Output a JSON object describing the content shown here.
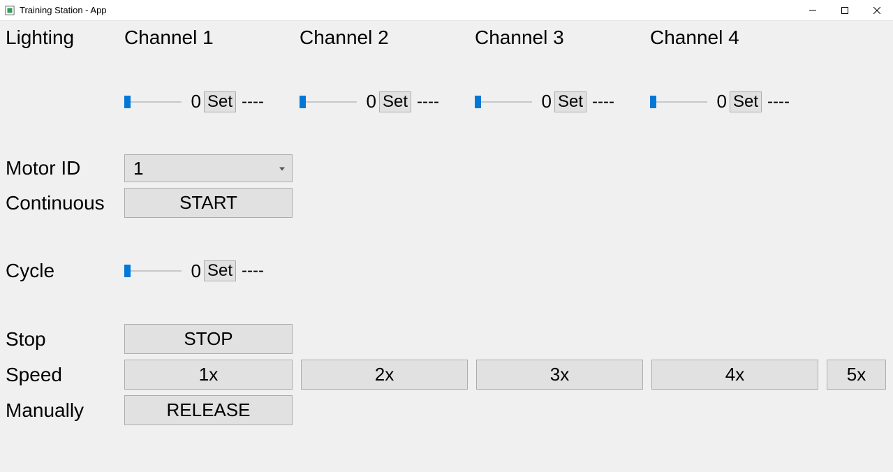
{
  "window": {
    "title": "Training Station - App"
  },
  "labels": {
    "lighting": "Lighting",
    "motor_id": "Motor ID",
    "continuous": "Continuous",
    "cycle": "Cycle",
    "stop": "Stop",
    "speed": "Speed",
    "manually": "Manually"
  },
  "channels": [
    {
      "label": "Channel 1",
      "value": "0",
      "set": "Set",
      "status": "----"
    },
    {
      "label": "Channel 2",
      "value": "0",
      "set": "Set",
      "status": "----"
    },
    {
      "label": "Channel 3",
      "value": "0",
      "set": "Set",
      "status": "----"
    },
    {
      "label": "Channel 4",
      "value": "0",
      "set": "Set",
      "status": "----"
    }
  ],
  "motor_id": {
    "selected": "1"
  },
  "continuous": {
    "button": "START"
  },
  "cycle": {
    "value": "0",
    "set": "Set",
    "status": "----"
  },
  "stop": {
    "button": "STOP"
  },
  "speed": {
    "options": [
      "1x",
      "2x",
      "3x",
      "4x",
      "5x"
    ]
  },
  "manually": {
    "button": "RELEASE"
  }
}
